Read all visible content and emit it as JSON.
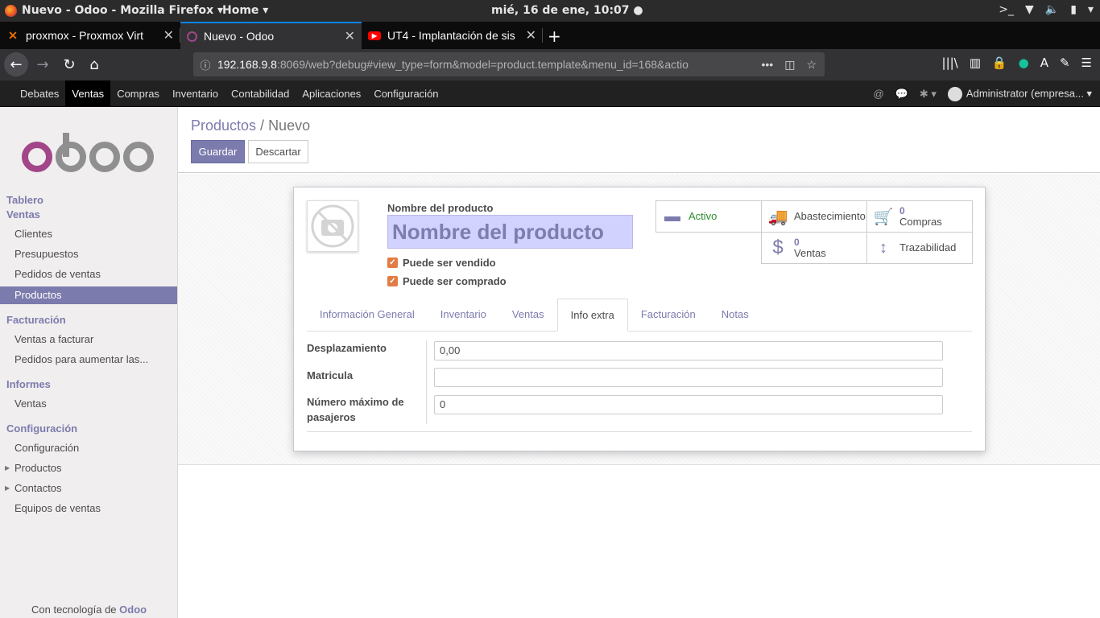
{
  "os_bar": {
    "app_name": "Nuevo - Odoo - Mozilla Firefox ▾",
    "home": "Home ▾",
    "clock": "mié, 16 de ene, 10:07 ●",
    "tray_icons": [
      "terminal-icon",
      "wifi-icon",
      "volume-icon",
      "battery-icon",
      "power-menu-icon"
    ]
  },
  "browser": {
    "tabs": [
      {
        "title": "proxmox - Proxmox Virt",
        "favicon": "proxmox-icon"
      },
      {
        "title": "Nuevo - Odoo",
        "favicon": "odoo-icon"
      },
      {
        "title": "UT4 - Implantación de sis",
        "favicon": "youtube-icon"
      }
    ],
    "url_host": "192.168.9.8",
    "url_rest": ":8069/web?debug#view_type=form&model=product.template&menu_id=168&actio"
  },
  "odoo_menu": {
    "items": [
      "Debates",
      "Ventas",
      "Compras",
      "Inventario",
      "Contabilidad",
      "Aplicaciones",
      "Configuración"
    ],
    "user": "Administrator (empresa..."
  },
  "sidebar": {
    "logo": "odoo",
    "sections": [
      {
        "title": "Tablero"
      },
      {
        "title": "Ventas",
        "items": [
          "Clientes",
          "Presupuestos",
          "Pedidos de ventas",
          "Productos"
        ]
      },
      {
        "title": "Facturación",
        "items": [
          "Ventas a facturar",
          "Pedidos para aumentar las..."
        ]
      },
      {
        "title": "Informes",
        "items": [
          "Ventas"
        ]
      },
      {
        "title": "Configuración",
        "items": [
          "Configuración",
          "Productos",
          "Contactos",
          "Equipos de ventas"
        ]
      }
    ],
    "footer_prefix": "Con tecnología de",
    "footer_brand": "Odoo"
  },
  "control_panel": {
    "breadcrumb_parent": "Productos",
    "breadcrumb_sep": "/",
    "breadcrumb_current": "Nuevo",
    "save": "Guardar",
    "discard": "Descartar"
  },
  "form": {
    "name_label": "Nombre del producto",
    "name_placeholder": "Nombre del producto",
    "can_be_sold": "Puede ser vendido",
    "can_be_purchased": "Puede ser comprado",
    "smart_buttons": {
      "active": "Activo",
      "procurement": "Abastecimiento",
      "purchases_count": "0",
      "purchases": "Compras",
      "sales_count": "0",
      "sales": "Ventas",
      "traceability": "Trazabilidad"
    },
    "tabs": [
      "Información General",
      "Inventario",
      "Ventas",
      "Info extra",
      "Facturación",
      "Notas"
    ],
    "active_tab": "Info extra",
    "fields": {
      "displacement_label": "Desplazamiento",
      "displacement_value": "0,00",
      "plate_label": "Matricula",
      "plate_value": "",
      "max_passengers_label": "Número máximo de pasajeros",
      "max_passengers_value": "0"
    }
  }
}
